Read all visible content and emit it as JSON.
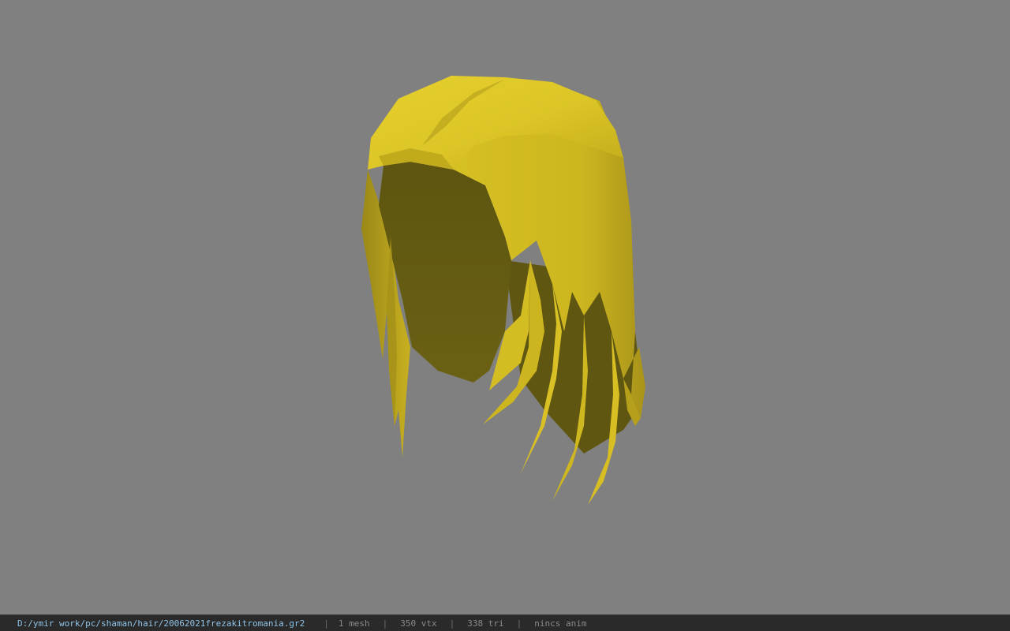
{
  "viewport": {
    "background": "#808080",
    "model_colors": {
      "hair_light": "#e2cb2a",
      "hair_mid": "#c9b11f",
      "hair_dark": "#6e6214",
      "hair_interior": "#5e5612"
    }
  },
  "statusbar": {
    "file_path": "D:/ymir work/pc/shaman/hair/20062021frezakitromania.gr2",
    "separator": "|",
    "mesh_count": "1 mesh",
    "vertex_count": "350 vtx",
    "triangle_count": "338 tri",
    "anim_status": "nincs anim"
  }
}
